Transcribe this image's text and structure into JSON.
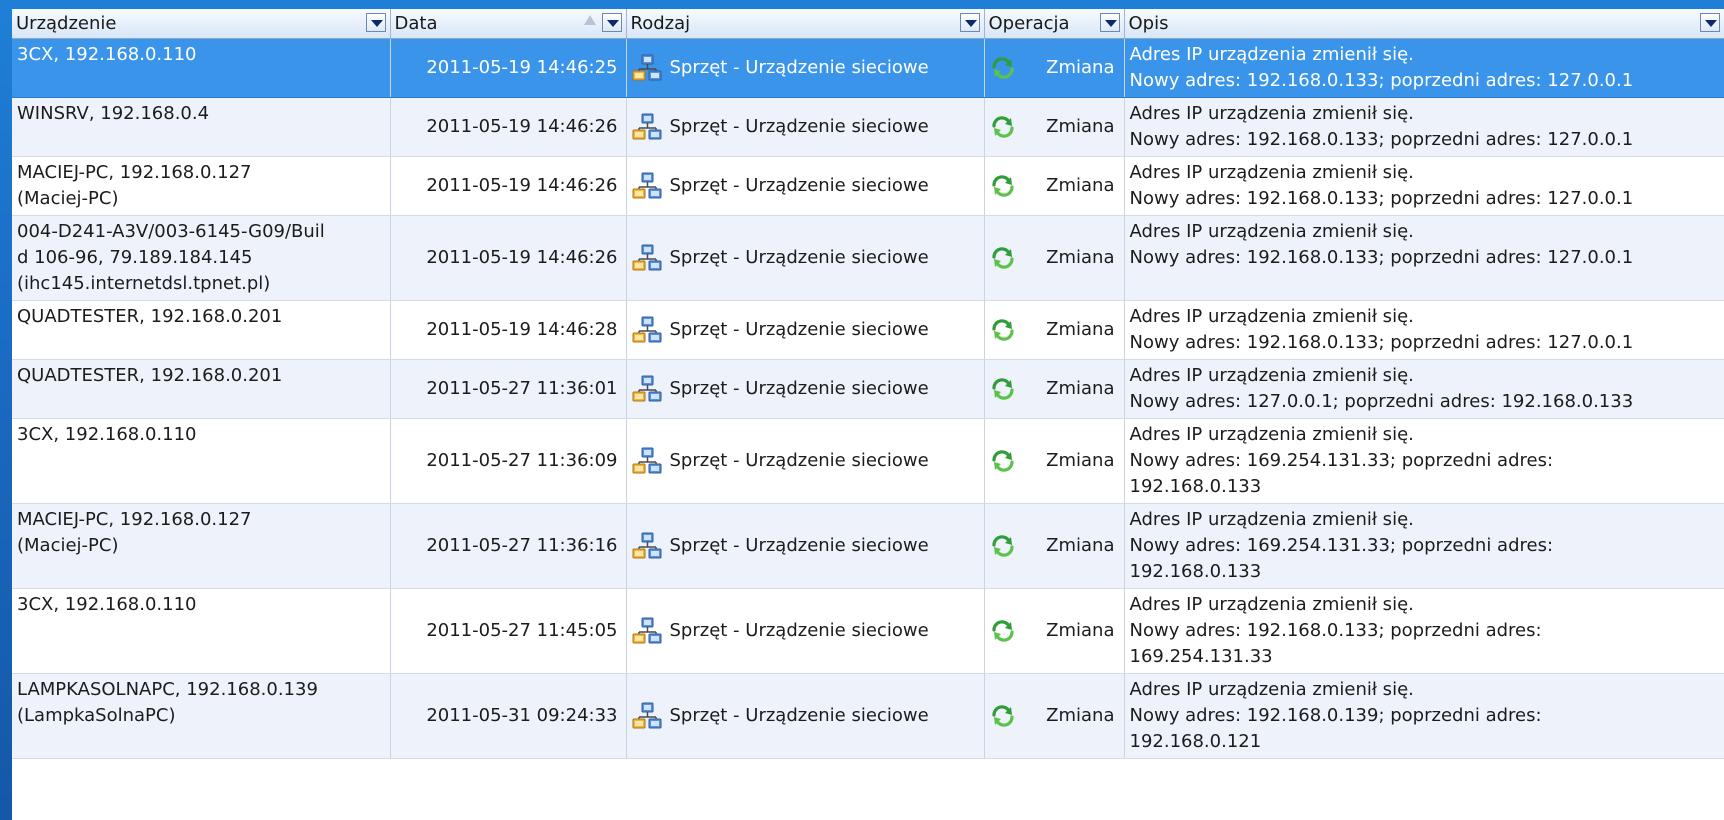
{
  "columns": {
    "device": "Urządzenie",
    "date": "Data",
    "type": "Rodzaj",
    "operation": "Operacja",
    "description": "Opis"
  },
  "rows": [
    {
      "device": [
        "3CX, 192.168.0.110"
      ],
      "date": "2011-05-19 14:46:25",
      "type": "Sprzęt - Urządzenie sieciowe",
      "operation": "Zmiana",
      "description": [
        "Adres IP urządzenia zmienił się.",
        "Nowy adres: 192.168.0.133; poprzedni adres: 127.0.0.1"
      ]
    },
    {
      "device": [
        "WINSRV, 192.168.0.4"
      ],
      "date": "2011-05-19 14:46:26",
      "type": "Sprzęt - Urządzenie sieciowe",
      "operation": "Zmiana",
      "description": [
        "Adres IP urządzenia zmienił się.",
        "Nowy adres: 192.168.0.133; poprzedni adres: 127.0.0.1"
      ]
    },
    {
      "device": [
        "MACIEJ-PC, 192.168.0.127",
        "(Maciej-PC)"
      ],
      "date": "2011-05-19 14:46:26",
      "type": "Sprzęt - Urządzenie sieciowe",
      "operation": "Zmiana",
      "description": [
        "Adres IP urządzenia zmienił się.",
        "Nowy adres: 192.168.0.133; poprzedni adres: 127.0.0.1"
      ]
    },
    {
      "device": [
        "004-D241-A3V/003-6145-G09/Buil",
        "d 106-96, 79.189.184.145",
        "(ihc145.internetdsl.tpnet.pl)"
      ],
      "date": "2011-05-19 14:46:26",
      "type": "Sprzęt - Urządzenie sieciowe",
      "operation": "Zmiana",
      "description": [
        "Adres IP urządzenia zmienił się.",
        "Nowy adres: 192.168.0.133; poprzedni adres: 127.0.0.1"
      ]
    },
    {
      "device": [
        "QUADTESTER, 192.168.0.201"
      ],
      "date": "2011-05-19 14:46:28",
      "type": "Sprzęt - Urządzenie sieciowe",
      "operation": "Zmiana",
      "description": [
        "Adres IP urządzenia zmienił się.",
        "Nowy adres: 192.168.0.133; poprzedni adres: 127.0.0.1"
      ]
    },
    {
      "device": [
        "QUADTESTER, 192.168.0.201"
      ],
      "date": "2011-05-27 11:36:01",
      "type": "Sprzęt - Urządzenie sieciowe",
      "operation": "Zmiana",
      "description": [
        "Adres IP urządzenia zmienił się.",
        "Nowy adres: 127.0.0.1; poprzedni adres: 192.168.0.133"
      ]
    },
    {
      "device": [
        "3CX, 192.168.0.110"
      ],
      "date": "2011-05-27 11:36:09",
      "type": "Sprzęt - Urządzenie sieciowe",
      "operation": "Zmiana",
      "description": [
        "Adres IP urządzenia zmienił się.",
        "Nowy adres: 169.254.131.33; poprzedni adres:",
        "192.168.0.133"
      ]
    },
    {
      "device": [
        "MACIEJ-PC, 192.168.0.127",
        "(Maciej-PC)"
      ],
      "date": "2011-05-27 11:36:16",
      "type": "Sprzęt - Urządzenie sieciowe",
      "operation": "Zmiana",
      "description": [
        "Adres IP urządzenia zmienił się.",
        "Nowy adres: 169.254.131.33; poprzedni adres:",
        "192.168.0.133"
      ]
    },
    {
      "device": [
        "3CX, 192.168.0.110"
      ],
      "date": "2011-05-27 11:45:05",
      "type": "Sprzęt - Urządzenie sieciowe",
      "operation": "Zmiana",
      "description": [
        "Adres IP urządzenia zmienił się.",
        "Nowy adres: 192.168.0.133; poprzedni adres:",
        "169.254.131.33"
      ]
    },
    {
      "device": [
        "LAMPKASOLNAPC, 192.168.0.139",
        "(LampkaSolnaPC)"
      ],
      "date": "2011-05-31 09:24:33",
      "type": "Sprzęt - Urządzenie sieciowe",
      "operation": "Zmiana",
      "description": [
        "Adres IP urządzenia zmienił się.",
        "Nowy adres: 192.168.0.139; poprzedni adres:",
        "192.168.0.121"
      ]
    }
  ],
  "selected_row": 0,
  "icons": {
    "type": "network-device-icon",
    "operation": "refresh-change-icon"
  },
  "colors": {
    "selection": "#3a95ea",
    "header": "#d8e6f6",
    "background": "#1a6cc4"
  }
}
